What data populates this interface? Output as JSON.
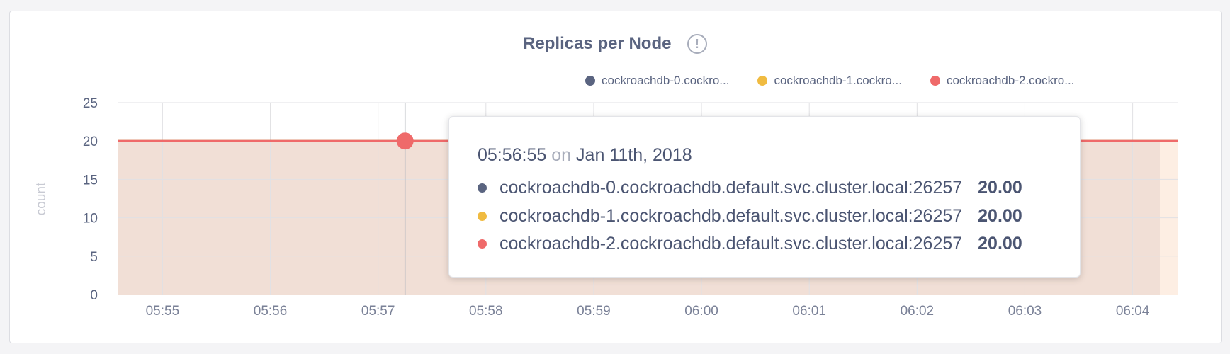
{
  "colors": {
    "node0": "#5a6480",
    "node1": "#f0bb41",
    "node2": "#ef6a6a",
    "area": "#f1dfd6",
    "area_edge": "#fdeee3",
    "grid": "#e1e1e4",
    "cursor": "#b6b8bf"
  },
  "icons": {
    "info": "info-icon"
  },
  "header": {
    "title": "Replicas per Node",
    "info_glyph": "!"
  },
  "legend": [
    {
      "label": "cockroachdb-0.cockro...",
      "color": "#5a6480"
    },
    {
      "label": "cockroachdb-1.cockro...",
      "color": "#f0bb41"
    },
    {
      "label": "cockroachdb-2.cockro...",
      "color": "#ef6a6a"
    }
  ],
  "tooltip": {
    "time": "05:56:55",
    "on": "on",
    "date": "Jan 11th, 2018",
    "rows": [
      {
        "name": "cockroachdb-0.cockroachdb.default.svc.cluster.local:26257",
        "value": "20.00",
        "color": "#5a6480"
      },
      {
        "name": "cockroachdb-1.cockroachdb.default.svc.cluster.local:26257",
        "value": "20.00",
        "color": "#f0bb41"
      },
      {
        "name": "cockroachdb-2.cockroachdb.default.svc.cluster.local:26257",
        "value": "20.00",
        "color": "#ef6a6a"
      }
    ]
  },
  "chart_data": {
    "type": "area",
    "title": "Replicas per Node",
    "ylabel": "count",
    "xlabel": "",
    "ylim": [
      0,
      25
    ],
    "yticks": [
      0,
      5,
      10,
      15,
      20,
      25
    ],
    "xlim": [
      "05:54:35",
      "06:04:25"
    ],
    "xticks": [
      "05:55",
      "05:56",
      "05:57",
      "05:58",
      "05:59",
      "06:00",
      "06:01",
      "06:02",
      "06:03",
      "06:04"
    ],
    "grid": true,
    "legend_position": "top-right",
    "hover_x": "05:57:15",
    "series": [
      {
        "name": "cockroachdb-0.cockro...",
        "x": [
          "05:54:35",
          "06:04:25"
        ],
        "values": [
          20,
          20
        ]
      },
      {
        "name": "cockroachdb-1.cockro...",
        "x": [
          "05:54:35",
          "06:04:25"
        ],
        "values": [
          20,
          20
        ]
      },
      {
        "name": "cockroachdb-2.cockro...",
        "x": [
          "05:54:35",
          "06:04:25"
        ],
        "values": [
          20,
          20
        ]
      }
    ]
  }
}
